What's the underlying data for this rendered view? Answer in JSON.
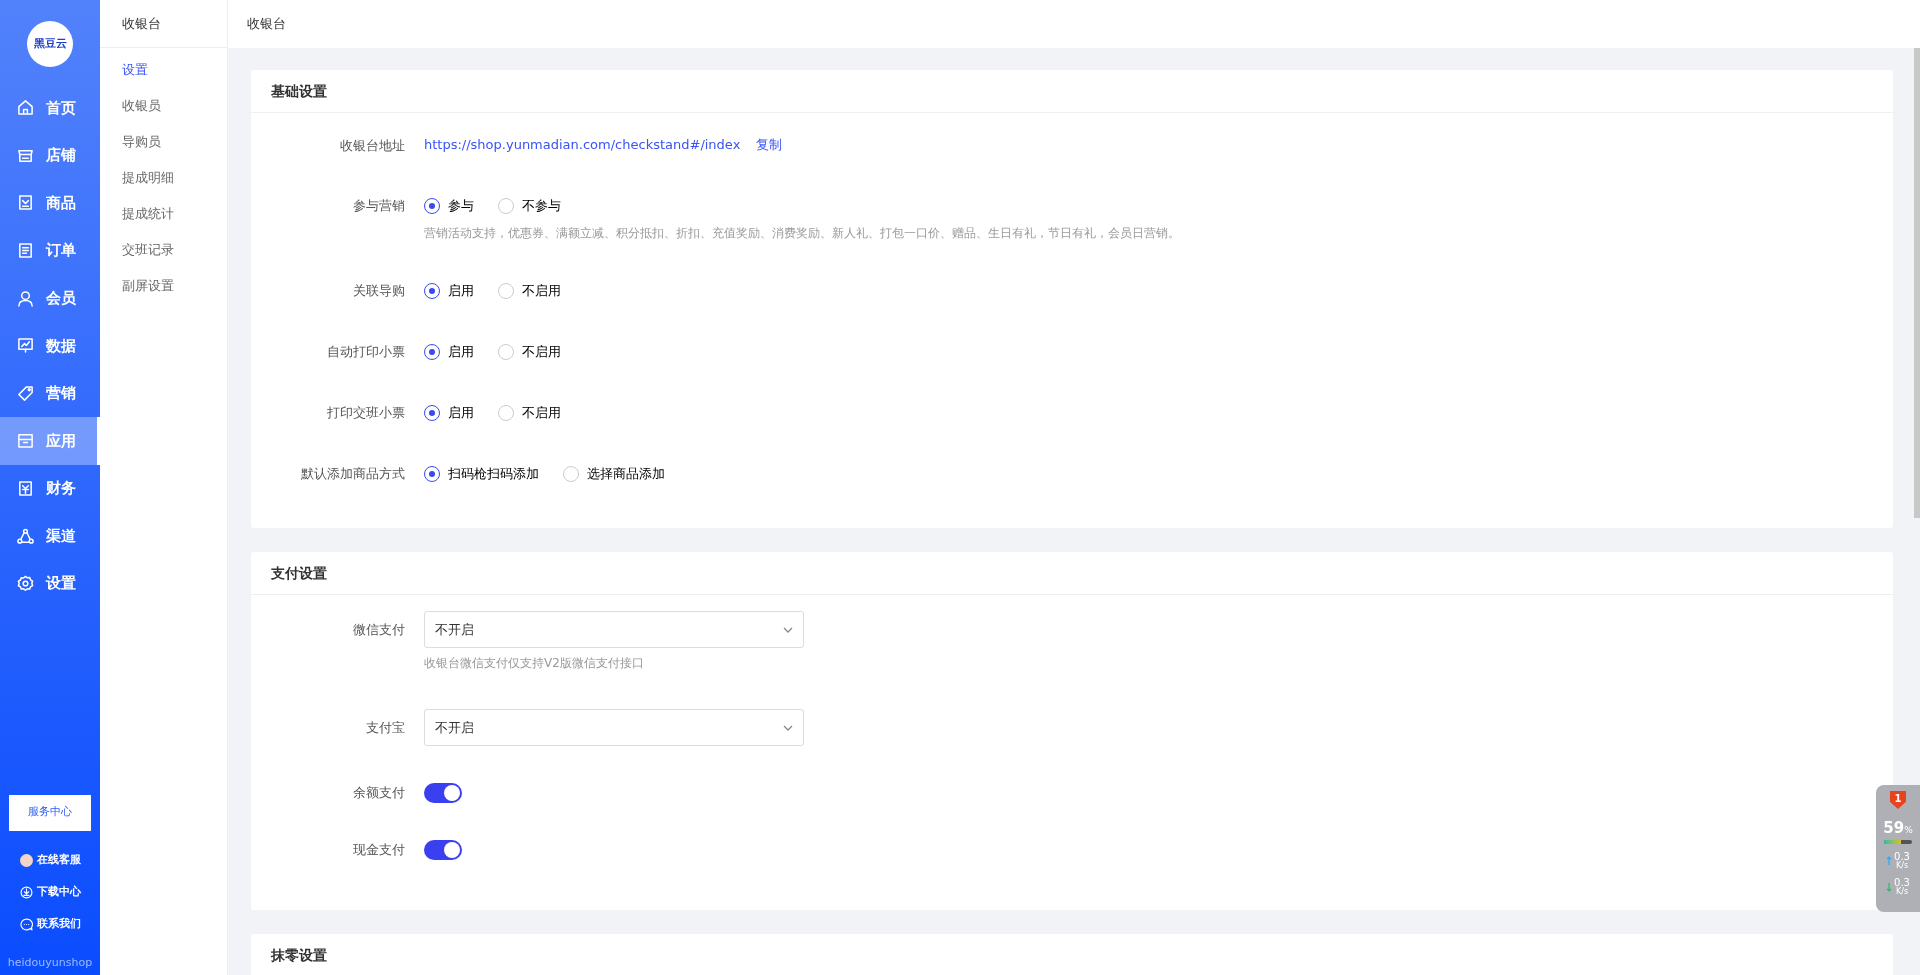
{
  "logo": {
    "text": "黑豆云"
  },
  "nav": [
    {
      "label": "首页",
      "selected": false
    },
    {
      "label": "店铺",
      "selected": false
    },
    {
      "label": "商品",
      "selected": false
    },
    {
      "label": "订单",
      "selected": false
    },
    {
      "label": "会员",
      "selected": false
    },
    {
      "label": "数据",
      "selected": false
    },
    {
      "label": "营销",
      "selected": false
    },
    {
      "label": "应用",
      "selected": true
    },
    {
      "label": "财务",
      "selected": false
    },
    {
      "label": "渠道",
      "selected": false
    },
    {
      "label": "设置",
      "selected": false
    }
  ],
  "service_button": "服务中心",
  "bottom_links": [
    {
      "label": "在线客服"
    },
    {
      "label": "下载中心"
    },
    {
      "label": "联系我们"
    }
  ],
  "footer_text": "heidouyunshop",
  "submenu": {
    "title": "收银台",
    "items": [
      {
        "label": "设置",
        "selected": true
      },
      {
        "label": "收银员",
        "selected": false
      },
      {
        "label": "导购员",
        "selected": false
      },
      {
        "label": "提成明细",
        "selected": false
      },
      {
        "label": "提成统计",
        "selected": false
      },
      {
        "label": "交班记录",
        "selected": false
      },
      {
        "label": "副屏设置",
        "selected": false
      }
    ]
  },
  "header": {
    "title": "收银台"
  },
  "sections": [
    {
      "title": "基础设置",
      "rows": [
        {
          "kind": "link",
          "label": "收银台地址",
          "url": "https://shop.yunmadian.com/checkstand#/index",
          "action": "复制"
        },
        {
          "kind": "radio",
          "label": "参与营销",
          "options": [
            {
              "label": "参与",
              "selected": true
            },
            {
              "label": "不参与",
              "selected": false
            }
          ],
          "hint": "营销活动支持，优惠券、满额立减、积分抵扣、折扣、充值奖励、消费奖励、新人礼、打包一口价、赠品、生日有礼，节日有礼，会员日营销。"
        },
        {
          "kind": "radio",
          "label": "关联导购",
          "options": [
            {
              "label": "启用",
              "selected": true
            },
            {
              "label": "不启用",
              "selected": false
            }
          ]
        },
        {
          "kind": "radio",
          "label": "自动打印小票",
          "options": [
            {
              "label": "启用",
              "selected": true
            },
            {
              "label": "不启用",
              "selected": false
            }
          ]
        },
        {
          "kind": "radio",
          "label": "打印交班小票",
          "options": [
            {
              "label": "启用",
              "selected": true
            },
            {
              "label": "不启用",
              "selected": false
            }
          ]
        },
        {
          "kind": "radio",
          "label": "默认添加商品方式",
          "options": [
            {
              "label": "扫码枪扫码添加",
              "selected": true
            },
            {
              "label": "选择商品添加",
              "selected": false
            }
          ]
        }
      ]
    },
    {
      "title": "支付设置",
      "rows": [
        {
          "kind": "select",
          "label": "微信支付",
          "value": "不开启",
          "hint": "收银台微信支付仅支持V2版微信支付接口"
        },
        {
          "kind": "select",
          "label": "支付宝",
          "value": "不开启"
        },
        {
          "kind": "switch",
          "label": "余额支付",
          "on": true
        },
        {
          "kind": "switch",
          "label": "现金支付",
          "on": true
        }
      ]
    },
    {
      "title": "抹零设置"
    }
  ],
  "monitor": {
    "badge": "1",
    "percent": "59",
    "unit": "%",
    "level": 0.59,
    "rates": [
      {
        "value": "0.3",
        "unit": "K/s"
      },
      {
        "value": "0.3",
        "unit": "K/s"
      }
    ]
  }
}
